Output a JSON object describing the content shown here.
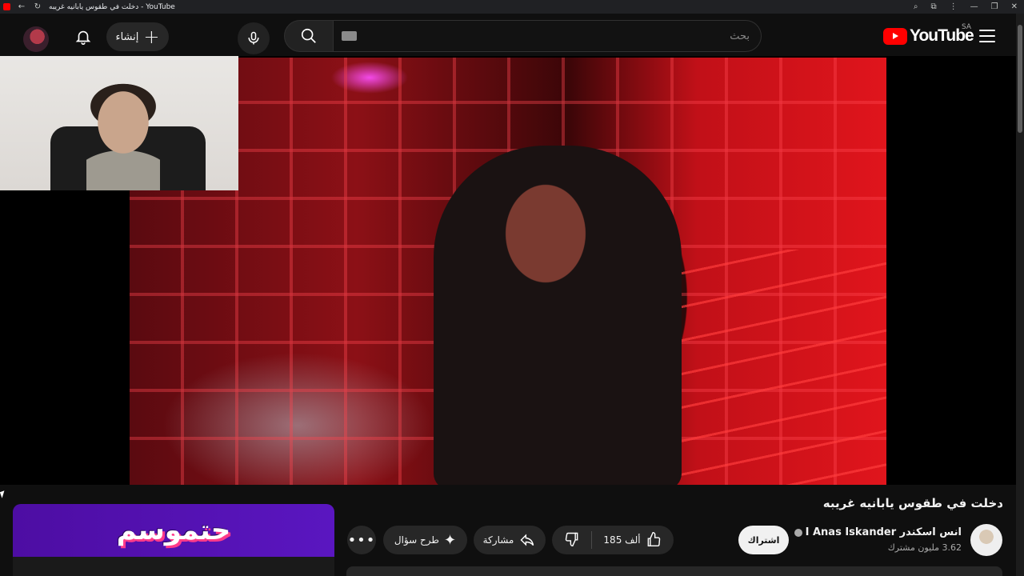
{
  "browser": {
    "tab_title": "دخلت في طقوس يابانيه غريبه - YouTube",
    "icons": [
      "back-icon",
      "reload-icon",
      "zoom-icon",
      "extensions-icon",
      "more-icon",
      "minimize-icon",
      "restore-icon",
      "close-icon"
    ]
  },
  "header": {
    "create_label": "إنشاء",
    "search_placeholder": "بحث",
    "logo_text": "YouTube",
    "country_code": "SA",
    "brand_color": "#ff0000"
  },
  "video": {
    "title": "دخلت في طقوس يابانيه غريبه"
  },
  "channel": {
    "name": "انس اسكندر I Anas Iskander",
    "subscribers": "3.62 مليون مشترك",
    "subscribe_label": "اشتراك"
  },
  "actions": {
    "likes": "185 ألف",
    "share_label": "مشاركة",
    "ask_label": "طرح سؤال"
  },
  "promo": {
    "text": "حتموسم"
  }
}
